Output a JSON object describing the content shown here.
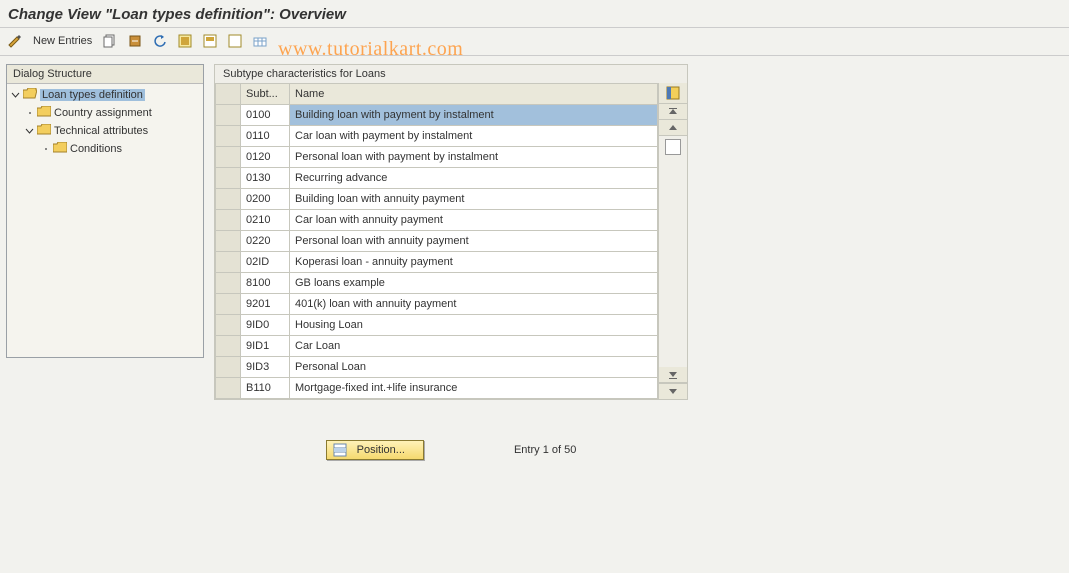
{
  "title": "Change View \"Loan types definition\": Overview",
  "watermark": "www.tutorialkart.com",
  "toolbar": {
    "new_entries": "New Entries"
  },
  "tree": {
    "header": "Dialog Structure",
    "items": [
      {
        "label": "Loan types definition",
        "indent": 0,
        "selected": true,
        "open_folder": true,
        "expander": true
      },
      {
        "label": "Country assignment",
        "indent": 1,
        "selected": false,
        "open_folder": false,
        "expander": false
      },
      {
        "label": "Technical attributes",
        "indent": 1,
        "selected": false,
        "open_folder": false,
        "expander": true
      },
      {
        "label": "Conditions",
        "indent": 2,
        "selected": false,
        "open_folder": false,
        "expander": false
      }
    ]
  },
  "table": {
    "title": "Subtype characteristics for Loans",
    "col1": "Subt...",
    "col2": "Name",
    "rows": [
      {
        "sub": "0100",
        "name": "Building loan with payment by instalment",
        "selected": true
      },
      {
        "sub": "0110",
        "name": "Car loan with payment by instalment"
      },
      {
        "sub": "0120",
        "name": "Personal loan with payment by instalment"
      },
      {
        "sub": "0130",
        "name": "Recurring advance"
      },
      {
        "sub": "0200",
        "name": "Building loan with annuity payment"
      },
      {
        "sub": "0210",
        "name": "Car loan with annuity payment"
      },
      {
        "sub": "0220",
        "name": "Personal loan with annuity payment"
      },
      {
        "sub": "02ID",
        "name": "Koperasi loan - annuity payment"
      },
      {
        "sub": "8100",
        "name": "GB loans example"
      },
      {
        "sub": "9201",
        "name": "401(k) loan with annuity payment"
      },
      {
        "sub": "9ID0",
        "name": "Housing Loan"
      },
      {
        "sub": "9ID1",
        "name": "Car Loan"
      },
      {
        "sub": "9ID3",
        "name": "Personal Loan"
      },
      {
        "sub": "B110",
        "name": "Mortgage-fixed int.+life insurance"
      }
    ]
  },
  "footer": {
    "position_btn": "Position...",
    "entry_text": "Entry 1 of 50"
  }
}
